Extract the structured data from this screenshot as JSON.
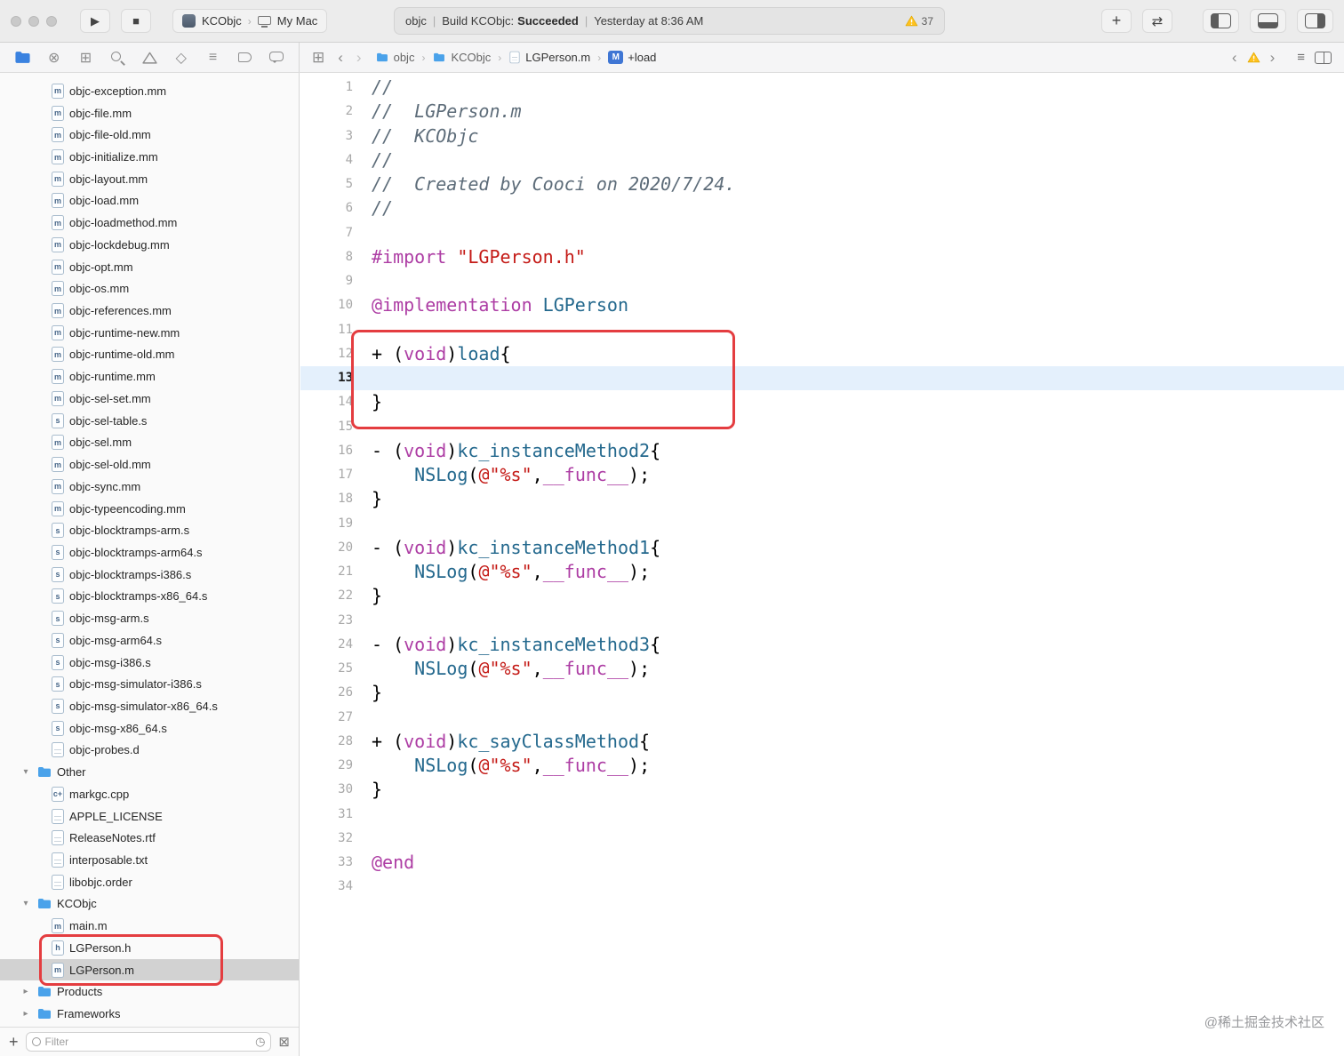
{
  "icons": {
    "play": "▶",
    "stop": "■",
    "plus": "+",
    "code_review": "⇄",
    "back": "‹",
    "forward": "›",
    "crumb_sep": "›",
    "related_items": "⊞",
    "source_control": "⊗",
    "symbols": "⊞",
    "tests": "◇",
    "debug": "≡",
    "lines": "≡",
    "clock": "◷",
    "clear_filter": "⊠",
    "disclosure_open": "▾",
    "disclosure_closed": "▸"
  },
  "toolbar": {
    "scheme": "KCObjc",
    "destination": "My Mac",
    "status": {
      "project": "objc",
      "sep": "|",
      "build_prefix": "Build KCObjc:",
      "build_result": "Succeeded",
      "time": "Yesterday at 8:36 AM"
    },
    "warning_count": "37"
  },
  "jumpbar": {
    "crumbs": [
      {
        "label": "objc",
        "icon": "folder"
      },
      {
        "label": "KCObjc",
        "icon": "folder"
      },
      {
        "label": "LGPerson.m",
        "icon": "file"
      },
      {
        "label": "+load",
        "icon": "m-badge",
        "badge": "M"
      }
    ]
  },
  "sidebar": {
    "items": [
      {
        "label": "objc-exception.mm",
        "icon": "m",
        "indent": 2
      },
      {
        "label": "objc-file.mm",
        "icon": "m",
        "indent": 2
      },
      {
        "label": "objc-file-old.mm",
        "icon": "m",
        "indent": 2
      },
      {
        "label": "objc-initialize.mm",
        "icon": "m",
        "indent": 2
      },
      {
        "label": "objc-layout.mm",
        "icon": "m",
        "indent": 2
      },
      {
        "label": "objc-load.mm",
        "icon": "m",
        "indent": 2
      },
      {
        "label": "objc-loadmethod.mm",
        "icon": "m",
        "indent": 2
      },
      {
        "label": "objc-lockdebug.mm",
        "icon": "m",
        "indent": 2
      },
      {
        "label": "objc-opt.mm",
        "icon": "m",
        "indent": 2
      },
      {
        "label": "objc-os.mm",
        "icon": "m",
        "indent": 2
      },
      {
        "label": "objc-references.mm",
        "icon": "m",
        "indent": 2
      },
      {
        "label": "objc-runtime-new.mm",
        "icon": "m",
        "indent": 2
      },
      {
        "label": "objc-runtime-old.mm",
        "icon": "m",
        "indent": 2
      },
      {
        "label": "objc-runtime.mm",
        "icon": "m",
        "indent": 2
      },
      {
        "label": "objc-sel-set.mm",
        "icon": "m",
        "indent": 2
      },
      {
        "label": "objc-sel-table.s",
        "icon": "s",
        "indent": 2
      },
      {
        "label": "objc-sel.mm",
        "icon": "m",
        "indent": 2
      },
      {
        "label": "objc-sel-old.mm",
        "icon": "m",
        "indent": 2
      },
      {
        "label": "objc-sync.mm",
        "icon": "m",
        "indent": 2
      },
      {
        "label": "objc-typeencoding.mm",
        "icon": "m",
        "indent": 2
      },
      {
        "label": "objc-blocktramps-arm.s",
        "icon": "s",
        "indent": 2
      },
      {
        "label": "objc-blocktramps-arm64.s",
        "icon": "s",
        "indent": 2
      },
      {
        "label": "objc-blocktramps-i386.s",
        "icon": "s",
        "indent": 2
      },
      {
        "label": "objc-blocktramps-x86_64.s",
        "icon": "s",
        "indent": 2
      },
      {
        "label": "objc-msg-arm.s",
        "icon": "s",
        "indent": 2
      },
      {
        "label": "objc-msg-arm64.s",
        "icon": "s",
        "indent": 2
      },
      {
        "label": "objc-msg-i386.s",
        "icon": "s",
        "indent": 2
      },
      {
        "label": "objc-msg-simulator-i386.s",
        "icon": "s",
        "indent": 2
      },
      {
        "label": "objc-msg-simulator-x86_64.s",
        "icon": "s",
        "indent": 2
      },
      {
        "label": "objc-msg-x86_64.s",
        "icon": "s",
        "indent": 2
      },
      {
        "label": "objc-probes.d",
        "icon": "doc",
        "indent": 2
      },
      {
        "label": "Other",
        "icon": "folder",
        "indent": 1,
        "expanded": true
      },
      {
        "label": "markgc.cpp",
        "icon": "c+",
        "indent": 2
      },
      {
        "label": "APPLE_LICENSE",
        "icon": "doc",
        "indent": 2
      },
      {
        "label": "ReleaseNotes.rtf",
        "icon": "doc",
        "indent": 2
      },
      {
        "label": "interposable.txt",
        "icon": "doc",
        "indent": 2
      },
      {
        "label": "libobjc.order",
        "icon": "doc",
        "indent": 2
      },
      {
        "label": "KCObjc",
        "icon": "folder",
        "indent": 1,
        "expanded": true
      },
      {
        "label": "main.m",
        "icon": "m",
        "indent": 2
      },
      {
        "label": "LGPerson.h",
        "icon": "h",
        "indent": 2
      },
      {
        "label": "LGPerson.m",
        "icon": "m",
        "indent": 2,
        "selected": true
      },
      {
        "label": "Products",
        "icon": "folder",
        "indent": 1,
        "expanded": false
      },
      {
        "label": "Frameworks",
        "icon": "folder",
        "indent": 1,
        "expanded": false
      }
    ],
    "filter": {
      "placeholder": "Filter"
    }
  },
  "editor": {
    "current_line": 13,
    "token_colors": {
      "comment": "#5D6C79",
      "keyword": "#AD3DA4",
      "string": "#C41A16",
      "type": "#23688D"
    },
    "lines": [
      {
        "n": 1,
        "tokens": [
          [
            "//",
            "comment"
          ]
        ]
      },
      {
        "n": 2,
        "tokens": [
          [
            "//  LGPerson.m",
            "comment"
          ]
        ]
      },
      {
        "n": 3,
        "tokens": [
          [
            "//  KCObjc",
            "comment"
          ]
        ]
      },
      {
        "n": 4,
        "tokens": [
          [
            "//",
            "comment"
          ]
        ]
      },
      {
        "n": 5,
        "tokens": [
          [
            "//  Created by Cooci on 2020/7/24.",
            "comment"
          ]
        ]
      },
      {
        "n": 6,
        "tokens": [
          [
            "//",
            "comment"
          ]
        ]
      },
      {
        "n": 7,
        "tokens": []
      },
      {
        "n": 8,
        "tokens": [
          [
            "#import",
            "keyword"
          ],
          [
            " ",
            "plain"
          ],
          [
            "\"LGPerson.h\"",
            "string"
          ]
        ]
      },
      {
        "n": 9,
        "tokens": []
      },
      {
        "n": 10,
        "tokens": [
          [
            "@implementation",
            "keyword"
          ],
          [
            " ",
            "plain"
          ],
          [
            "LGPerson",
            "type"
          ]
        ]
      },
      {
        "n": 11,
        "tokens": []
      },
      {
        "n": 12,
        "tokens": [
          [
            "+ (",
            "plain"
          ],
          [
            "void",
            "keyword"
          ],
          [
            ")",
            "plain"
          ],
          [
            "load",
            "type"
          ],
          [
            "{",
            "plain"
          ]
        ]
      },
      {
        "n": 13,
        "tokens": []
      },
      {
        "n": 14,
        "tokens": [
          [
            "}",
            "plain"
          ]
        ]
      },
      {
        "n": 15,
        "tokens": []
      },
      {
        "n": 16,
        "tokens": [
          [
            "- (",
            "plain"
          ],
          [
            "void",
            "keyword"
          ],
          [
            ")",
            "plain"
          ],
          [
            "kc_instanceMethod2",
            "type"
          ],
          [
            "{",
            "plain"
          ]
        ]
      },
      {
        "n": 17,
        "tokens": [
          [
            "    ",
            "plain"
          ],
          [
            "NSLog",
            "type"
          ],
          [
            "(",
            "plain"
          ],
          [
            "@\"%s\"",
            "string"
          ],
          [
            ",",
            "plain"
          ],
          [
            "__func__",
            "keyword"
          ],
          [
            ");",
            "plain"
          ]
        ]
      },
      {
        "n": 18,
        "tokens": [
          [
            "}",
            "plain"
          ]
        ]
      },
      {
        "n": 19,
        "tokens": []
      },
      {
        "n": 20,
        "tokens": [
          [
            "- (",
            "plain"
          ],
          [
            "void",
            "keyword"
          ],
          [
            ")",
            "plain"
          ],
          [
            "kc_instanceMethod1",
            "type"
          ],
          [
            "{",
            "plain"
          ]
        ]
      },
      {
        "n": 21,
        "tokens": [
          [
            "    ",
            "plain"
          ],
          [
            "NSLog",
            "type"
          ],
          [
            "(",
            "plain"
          ],
          [
            "@\"%s\"",
            "string"
          ],
          [
            ",",
            "plain"
          ],
          [
            "__func__",
            "keyword"
          ],
          [
            ");",
            "plain"
          ]
        ]
      },
      {
        "n": 22,
        "tokens": [
          [
            "}",
            "plain"
          ]
        ]
      },
      {
        "n": 23,
        "tokens": []
      },
      {
        "n": 24,
        "tokens": [
          [
            "- (",
            "plain"
          ],
          [
            "void",
            "keyword"
          ],
          [
            ")",
            "plain"
          ],
          [
            "kc_instanceMethod3",
            "type"
          ],
          [
            "{",
            "plain"
          ]
        ]
      },
      {
        "n": 25,
        "tokens": [
          [
            "    ",
            "plain"
          ],
          [
            "NSLog",
            "type"
          ],
          [
            "(",
            "plain"
          ],
          [
            "@\"%s\"",
            "string"
          ],
          [
            ",",
            "plain"
          ],
          [
            "__func__",
            "keyword"
          ],
          [
            ");",
            "plain"
          ]
        ]
      },
      {
        "n": 26,
        "tokens": [
          [
            "}",
            "plain"
          ]
        ]
      },
      {
        "n": 27,
        "tokens": []
      },
      {
        "n": 28,
        "tokens": [
          [
            "+ (",
            "plain"
          ],
          [
            "void",
            "keyword"
          ],
          [
            ")",
            "plain"
          ],
          [
            "kc_sayClassMethod",
            "type"
          ],
          [
            "{",
            "plain"
          ]
        ]
      },
      {
        "n": 29,
        "tokens": [
          [
            "    ",
            "plain"
          ],
          [
            "NSLog",
            "type"
          ],
          [
            "(",
            "plain"
          ],
          [
            "@\"%s\"",
            "string"
          ],
          [
            ",",
            "plain"
          ],
          [
            "__func__",
            "keyword"
          ],
          [
            ");",
            "plain"
          ]
        ]
      },
      {
        "n": 30,
        "tokens": [
          [
            "}",
            "plain"
          ]
        ]
      },
      {
        "n": 31,
        "tokens": []
      },
      {
        "n": 32,
        "tokens": []
      },
      {
        "n": 33,
        "tokens": [
          [
            "@end",
            "keyword"
          ]
        ]
      },
      {
        "n": 34,
        "tokens": []
      }
    ]
  },
  "annotations": {
    "color": "#E43D40"
  },
  "watermark": {
    "text": "@稀土掘金技术社区"
  }
}
